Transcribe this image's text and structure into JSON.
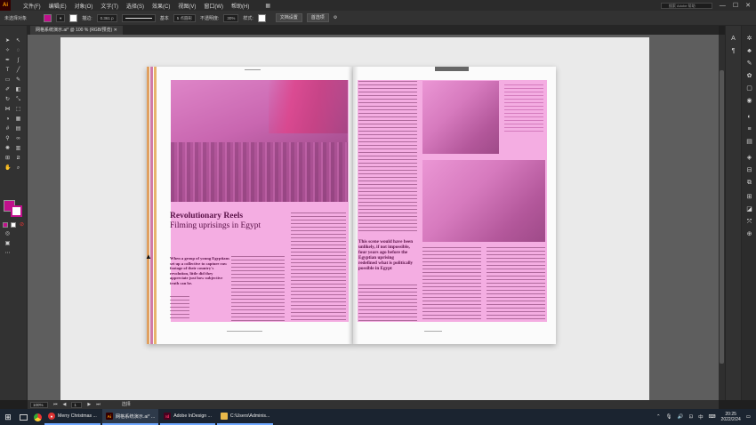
{
  "menubar": {
    "logo": "Ai",
    "menus": [
      "文件(F)",
      "编辑(E)",
      "对象(O)",
      "文字(T)",
      "选择(S)",
      "效果(C)",
      "视图(V)",
      "窗口(W)",
      "帮助(H)"
    ],
    "grid_icon": "grid-icon",
    "search_placeholder": "搜索 Adobe 帮助",
    "minimize": "—",
    "maximize": "☐",
    "close": "✕"
  },
  "controlbar": {
    "selection_label": "未选择对象",
    "fill_color": "#c0108c",
    "stroke_label": "描边:",
    "stroke_width": "0.361 p",
    "brush_label": "基本",
    "point_label": "5 点圆形",
    "opacity_label": "不透明度:",
    "opacity_value": "30%",
    "style_label": "样式:",
    "doc_setup": "文档设置",
    "preferences": "首选项"
  },
  "tab": {
    "title": "网格系统演示.ai* @ 100 % (RGB/预览)"
  },
  "article": {
    "heading_bold": "Revolutionary Reels",
    "heading_sub": "Filming uprisings in Egypt",
    "lede": "When a group of young Egyptians set up a collective to capture raw footage of their country's revolution, little did they appreciate just how subjective truth can be.",
    "pullquote": "This scene would have been unlikely, if not impossible, four years ago before the Egyptian uprising redefined what is politically possible in Egypt",
    "accent_color": "#ee6ecd"
  },
  "status": {
    "zoom": "100%",
    "page": "1",
    "tool": "选择"
  },
  "taskbar": {
    "apps": [
      {
        "label": "Merry Christmas ...",
        "icon": "chrome-icon"
      },
      {
        "label": "网格系统演示.ai* ...",
        "icon": "Ai"
      },
      {
        "label": "Adobe InDesign ...",
        "icon": "Id"
      },
      {
        "label": "C:\\Users\\Adminis...",
        "icon": "folder-icon"
      }
    ],
    "lang": "中",
    "time": "20:25",
    "date": "2022/2/24"
  }
}
